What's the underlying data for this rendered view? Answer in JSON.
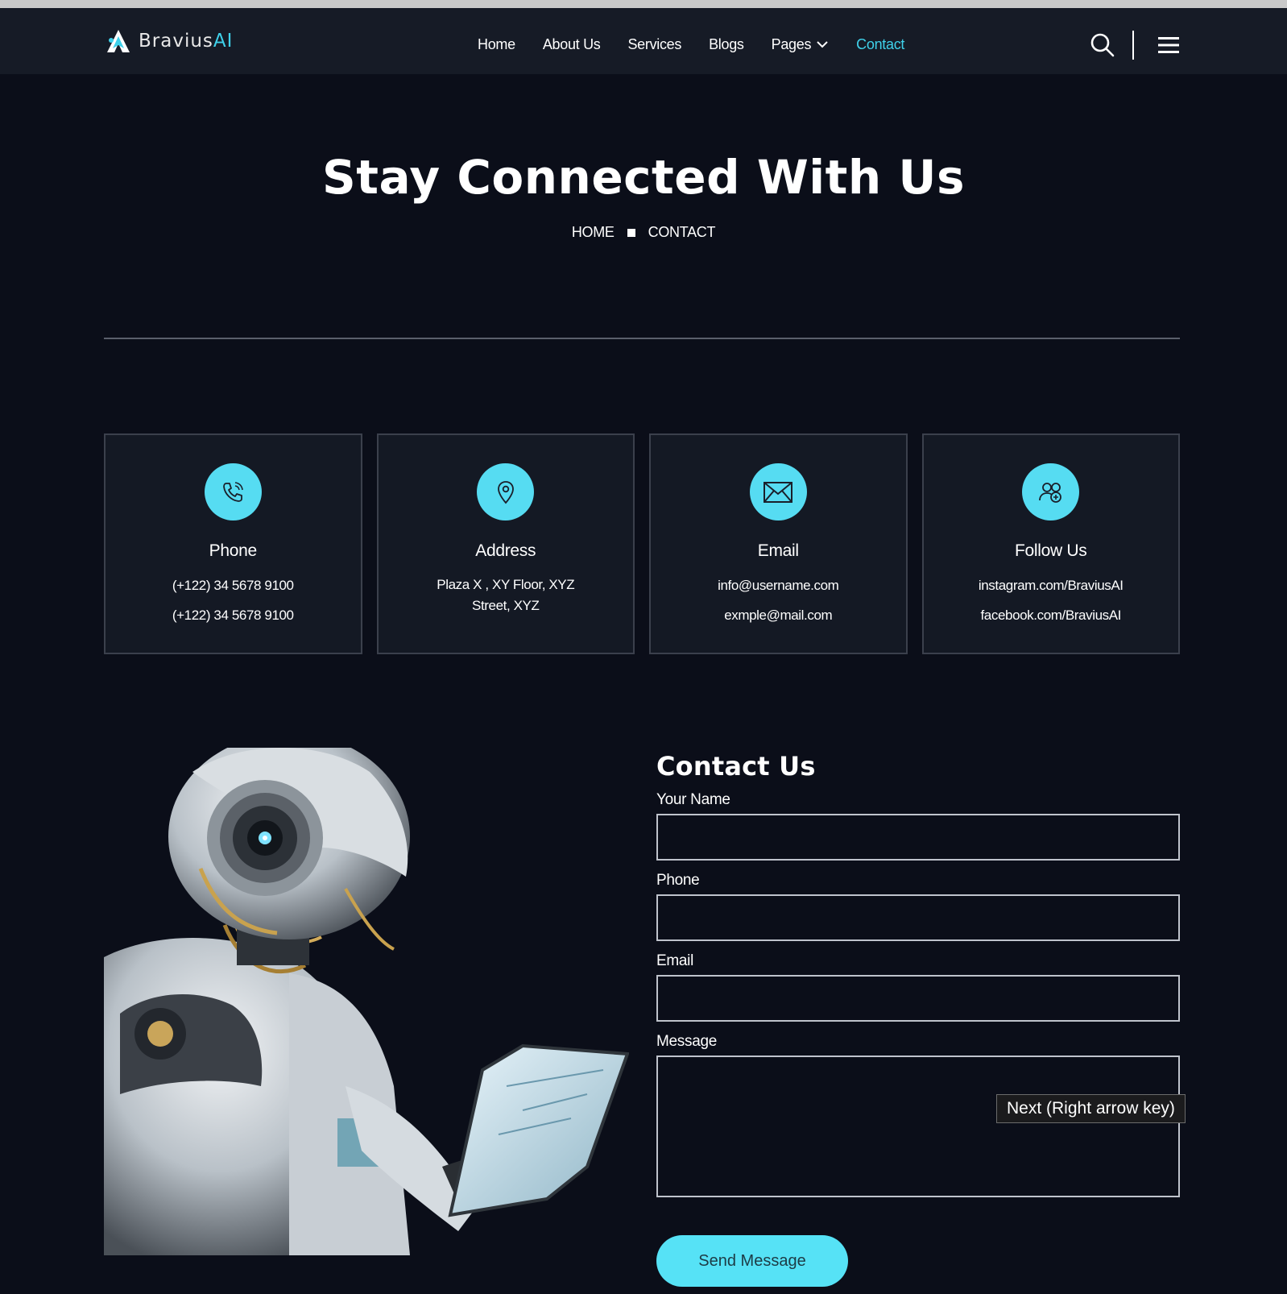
{
  "brand": {
    "name_main": "Bravius",
    "name_accent": "AI",
    "logo_icon": "brand-logo-icon"
  },
  "nav": {
    "items": [
      {
        "label": "Home",
        "active": false
      },
      {
        "label": "About Us",
        "active": false
      },
      {
        "label": "Services",
        "active": false
      },
      {
        "label": "Blogs",
        "active": false
      },
      {
        "label": "Pages",
        "active": false,
        "has_dropdown": true
      },
      {
        "label": "Contact",
        "active": true
      }
    ],
    "search_icon": "search-icon",
    "menu_icon": "hamburger-menu-icon"
  },
  "hero": {
    "title": "Stay Connected With Us",
    "breadcrumb": [
      "HOME",
      "CONTACT"
    ]
  },
  "cards": [
    {
      "icon": "phone-icon",
      "title": "Phone",
      "lines": [
        "(+122) 34 5678 9100",
        "(+122) 34 5678 9100"
      ]
    },
    {
      "icon": "location-pin-icon",
      "title": "Address",
      "lines": [
        "Plaza X , XY Floor, XYZ Street, XYZ"
      ]
    },
    {
      "icon": "mail-icon",
      "title": "Email",
      "lines": [
        "info@username.com",
        "exmple@mail.com"
      ]
    },
    {
      "icon": "users-icon",
      "title": "Follow Us",
      "lines": [
        "instagram.com/BraviusAI",
        "facebook.com/BraviusAI"
      ]
    }
  ],
  "image": {
    "description_icon": "robot-tablet-illustration"
  },
  "form": {
    "title": "Contact Us",
    "fields": {
      "name": {
        "label": "Your Name",
        "value": ""
      },
      "phone": {
        "label": "Phone",
        "value": ""
      },
      "email": {
        "label": "Email",
        "value": ""
      },
      "message": {
        "label": "Message",
        "value": ""
      }
    },
    "submit_label": "Send Message"
  },
  "tooltip": {
    "text": "Next (Right arrow key)"
  },
  "colors": {
    "background": "#0b0e19",
    "navbar": "#161b26",
    "accent": "#3fd1ea",
    "icon_circle": "#56dcf2",
    "button": "#56e2f6",
    "card_bg": "#141924",
    "card_border": "#3b404c"
  }
}
